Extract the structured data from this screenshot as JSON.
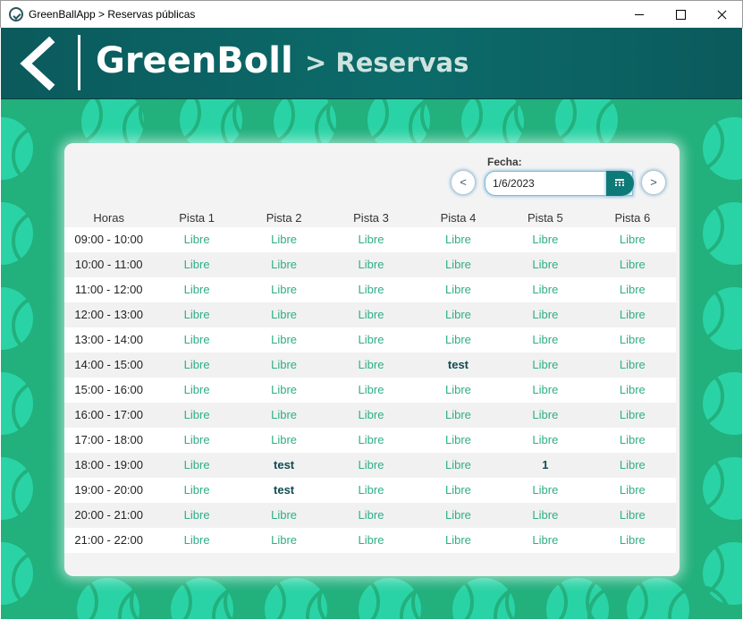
{
  "window": {
    "title": "GreenBallApp > Reservas públicas"
  },
  "header": {
    "logo_text": "GreenBoll",
    "section": "> Reservas"
  },
  "date": {
    "label": "Fecha:",
    "value": "1/6/2023",
    "prev_label": "<",
    "next_label": ">"
  },
  "table": {
    "hours_header": "Horas",
    "courts": [
      "Pista 1",
      "Pista 2",
      "Pista 3",
      "Pista 4",
      "Pista 5",
      "Pista 6"
    ],
    "rows": [
      {
        "hour": "09:00 - 10:00",
        "slots": [
          "Libre",
          "Libre",
          "Libre",
          "Libre",
          "Libre",
          "Libre"
        ]
      },
      {
        "hour": "10:00 - 11:00",
        "slots": [
          "Libre",
          "Libre",
          "Libre",
          "Libre",
          "Libre",
          "Libre"
        ]
      },
      {
        "hour": "11:00 - 12:00",
        "slots": [
          "Libre",
          "Libre",
          "Libre",
          "Libre",
          "Libre",
          "Libre"
        ]
      },
      {
        "hour": "12:00 - 13:00",
        "slots": [
          "Libre",
          "Libre",
          "Libre",
          "Libre",
          "Libre",
          "Libre"
        ]
      },
      {
        "hour": "13:00 - 14:00",
        "slots": [
          "Libre",
          "Libre",
          "Libre",
          "Libre",
          "Libre",
          "Libre"
        ]
      },
      {
        "hour": "14:00 - 15:00",
        "slots": [
          "Libre",
          "Libre",
          "Libre",
          "test",
          "Libre",
          "Libre"
        ]
      },
      {
        "hour": "15:00 - 16:00",
        "slots": [
          "Libre",
          "Libre",
          "Libre",
          "Libre",
          "Libre",
          "Libre"
        ]
      },
      {
        "hour": "16:00 - 17:00",
        "slots": [
          "Libre",
          "Libre",
          "Libre",
          "Libre",
          "Libre",
          "Libre"
        ]
      },
      {
        "hour": "17:00 - 18:00",
        "slots": [
          "Libre",
          "Libre",
          "Libre",
          "Libre",
          "Libre",
          "Libre"
        ]
      },
      {
        "hour": "18:00 - 19:00",
        "slots": [
          "Libre",
          "test",
          "Libre",
          "Libre",
          "1",
          "Libre"
        ]
      },
      {
        "hour": "19:00 - 20:00",
        "slots": [
          "Libre",
          "test",
          "Libre",
          "Libre",
          "Libre",
          "Libre"
        ]
      },
      {
        "hour": "20:00 - 21:00",
        "slots": [
          "Libre",
          "Libre",
          "Libre",
          "Libre",
          "Libre",
          "Libre"
        ]
      },
      {
        "hour": "21:00 - 22:00",
        "slots": [
          "Libre",
          "Libre",
          "Libre",
          "Libre",
          "Libre",
          "Libre"
        ]
      }
    ]
  },
  "colors": {
    "header_bg": "#0c6b6a",
    "body_bg": "#22b07c",
    "pattern_ball": "#2ad3a5",
    "free_text": "#2fae87",
    "booked_text": "#0f4c52"
  },
  "icons": {
    "app": "greenball-app-icon",
    "back": "chevron-left-icon",
    "calendar": "calendar-icon",
    "background_pattern": "tennis-ball-icon"
  }
}
